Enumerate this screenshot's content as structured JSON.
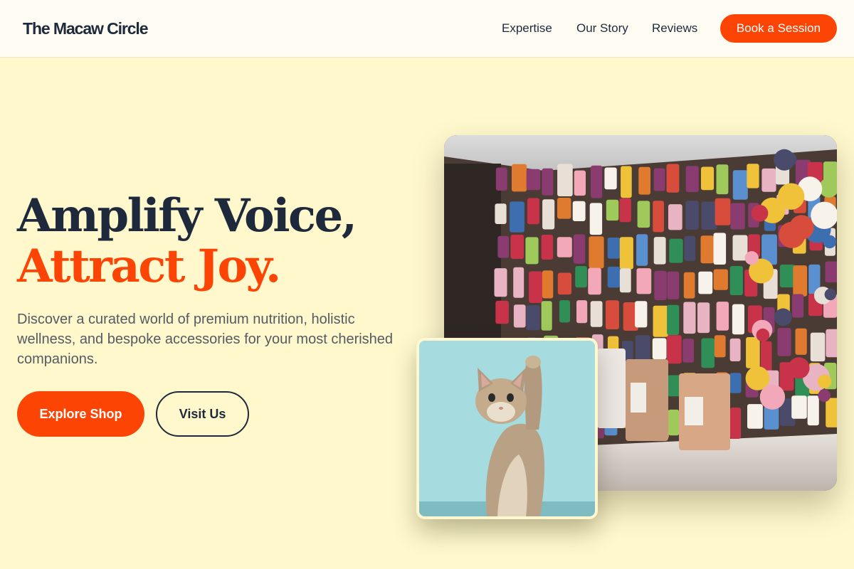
{
  "header": {
    "logo": "The Macaw Circle",
    "nav": [
      "Expertise",
      "Our Story",
      "Reviews"
    ],
    "cta": "Book a Session"
  },
  "hero": {
    "headline_line1": "Amplify Voice,",
    "headline_line2": "Attract Joy.",
    "subtitle": "Discover a curated world of premium nutrition, holistic wellness, and bespoke accessories for your most cherished companions.",
    "primary_button": "Explore Shop",
    "secondary_button": "Visit Us"
  },
  "colors": {
    "accent": "#fc4505",
    "navy": "#1e2a3b",
    "background": "#fef8cc"
  }
}
